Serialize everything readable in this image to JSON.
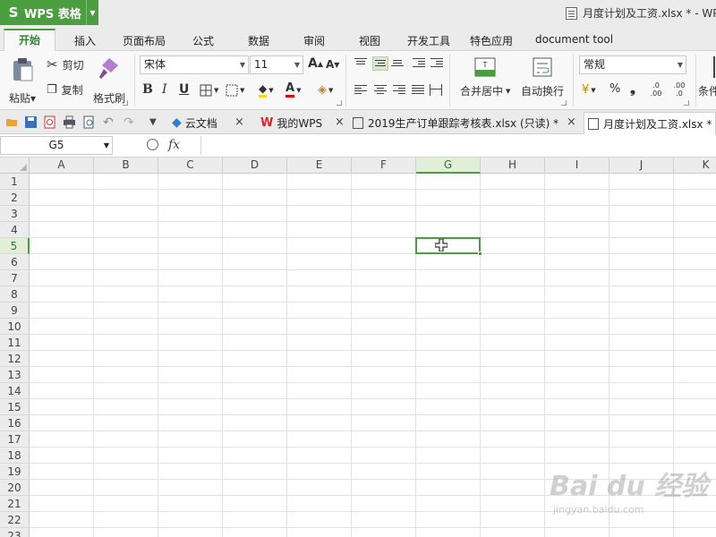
{
  "app": {
    "name": "WPS 表格",
    "window_title": "月度计划及工资.xlsx * - WP"
  },
  "menu_tabs": [
    "开始",
    "插入",
    "页面布局",
    "公式",
    "数据",
    "审阅",
    "视图",
    "开发工具",
    "特色应用",
    "document tool"
  ],
  "ribbon": {
    "paste": "粘贴",
    "cut": "剪切",
    "copy": "复制",
    "format_painter": "格式刷",
    "font_name": "宋体",
    "font_size": "11",
    "merge_center": "合并居中",
    "wrap_text": "自动换行",
    "number_format": "常规",
    "conditional": "条件",
    "bold": "B",
    "italic": "I",
    "underline": "U",
    "percent": "%",
    "comma": "❟",
    "inc_decimal": ".0 .00",
    "dec_decimal": ".00 .0"
  },
  "doc_tabs": [
    {
      "label": "云文档"
    },
    {
      "label": "我的WPS"
    },
    {
      "label": "2019生产订单跟踪考核表.xlsx (只读) *"
    },
    {
      "label": "月度计划及工资.xlsx *"
    }
  ],
  "formula_bar": {
    "cell_ref": "G5",
    "fx": "fx",
    "formula": ""
  },
  "grid": {
    "columns": [
      "A",
      "B",
      "C",
      "D",
      "E",
      "F",
      "G",
      "H",
      "I",
      "J",
      "K"
    ],
    "rows": [
      "1",
      "2",
      "3",
      "4",
      "5",
      "6",
      "7",
      "8",
      "9",
      "10",
      "11",
      "12",
      "13",
      "14",
      "15",
      "16",
      "17",
      "18",
      "19",
      "20",
      "21",
      "22",
      "23"
    ],
    "selected_col": "G",
    "selected_row": "5"
  },
  "colors": {
    "accent": "#4a9e3f",
    "selected_header_bg": "#e1efd9"
  },
  "watermark": {
    "main": "Bai du 经验",
    "sub": "jingyan.baidu.com"
  }
}
